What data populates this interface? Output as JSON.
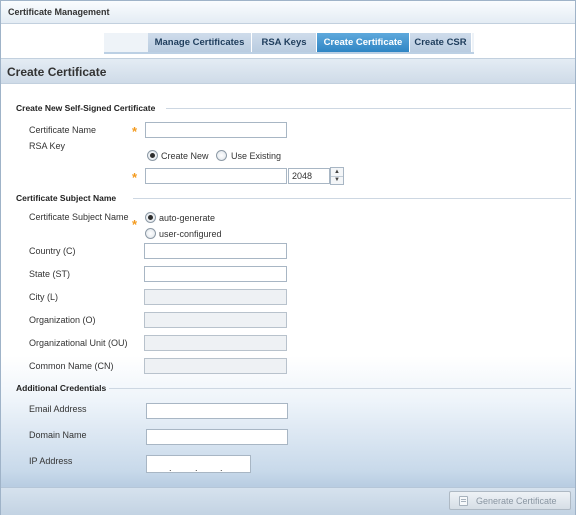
{
  "window": {
    "title": "Certificate Management"
  },
  "tabs": [
    {
      "label": "Manage Certificates",
      "active": false
    },
    {
      "label": "RSA Keys",
      "active": false
    },
    {
      "label": "Create Certificate",
      "active": true
    },
    {
      "label": "Create CSR",
      "active": false
    }
  ],
  "section": {
    "title": "Create Certificate"
  },
  "self_signed": {
    "title": "Create New  Self-Signed Certificate",
    "certificate_name": {
      "label": "Certificate Name",
      "value": ""
    },
    "rsa_key": {
      "label": "RSA Key",
      "options": [
        {
          "label": "Create New",
          "checked": true
        },
        {
          "label": "Use Existing",
          "checked": false
        }
      ],
      "key_name_value": "",
      "key_size_value": "2048"
    }
  },
  "subject": {
    "title": "Certificate Subject Name",
    "mode_label": "Certificate Subject Name",
    "modes": [
      {
        "label": "auto-generate",
        "checked": true
      },
      {
        "label": "user-configured",
        "checked": false
      }
    ],
    "fields": [
      {
        "label": "Country (C)",
        "value": "",
        "disabled": false
      },
      {
        "label": "State (ST)",
        "value": "",
        "disabled": false
      },
      {
        "label": "City (L)",
        "value": "",
        "disabled": true
      },
      {
        "label": "Organization (O)",
        "value": "",
        "disabled": true
      },
      {
        "label": "Organizational Unit (OU)",
        "value": "",
        "disabled": true
      },
      {
        "label": "Common Name (CN)",
        "value": "",
        "disabled": true
      }
    ]
  },
  "additional": {
    "title": "Additional Credentials",
    "email": {
      "label": "Email Address",
      "value": ""
    },
    "domain": {
      "label": "Domain Name",
      "value": ""
    },
    "ip": {
      "label": "IP Address",
      "separators": [
        ".",
        ".",
        "."
      ]
    }
  },
  "actions": {
    "generate_label": "Generate Certificate",
    "generate_enabled": false
  },
  "colors": {
    "accent_tab": "#2f85c4",
    "required_star": "#f39a1e"
  }
}
